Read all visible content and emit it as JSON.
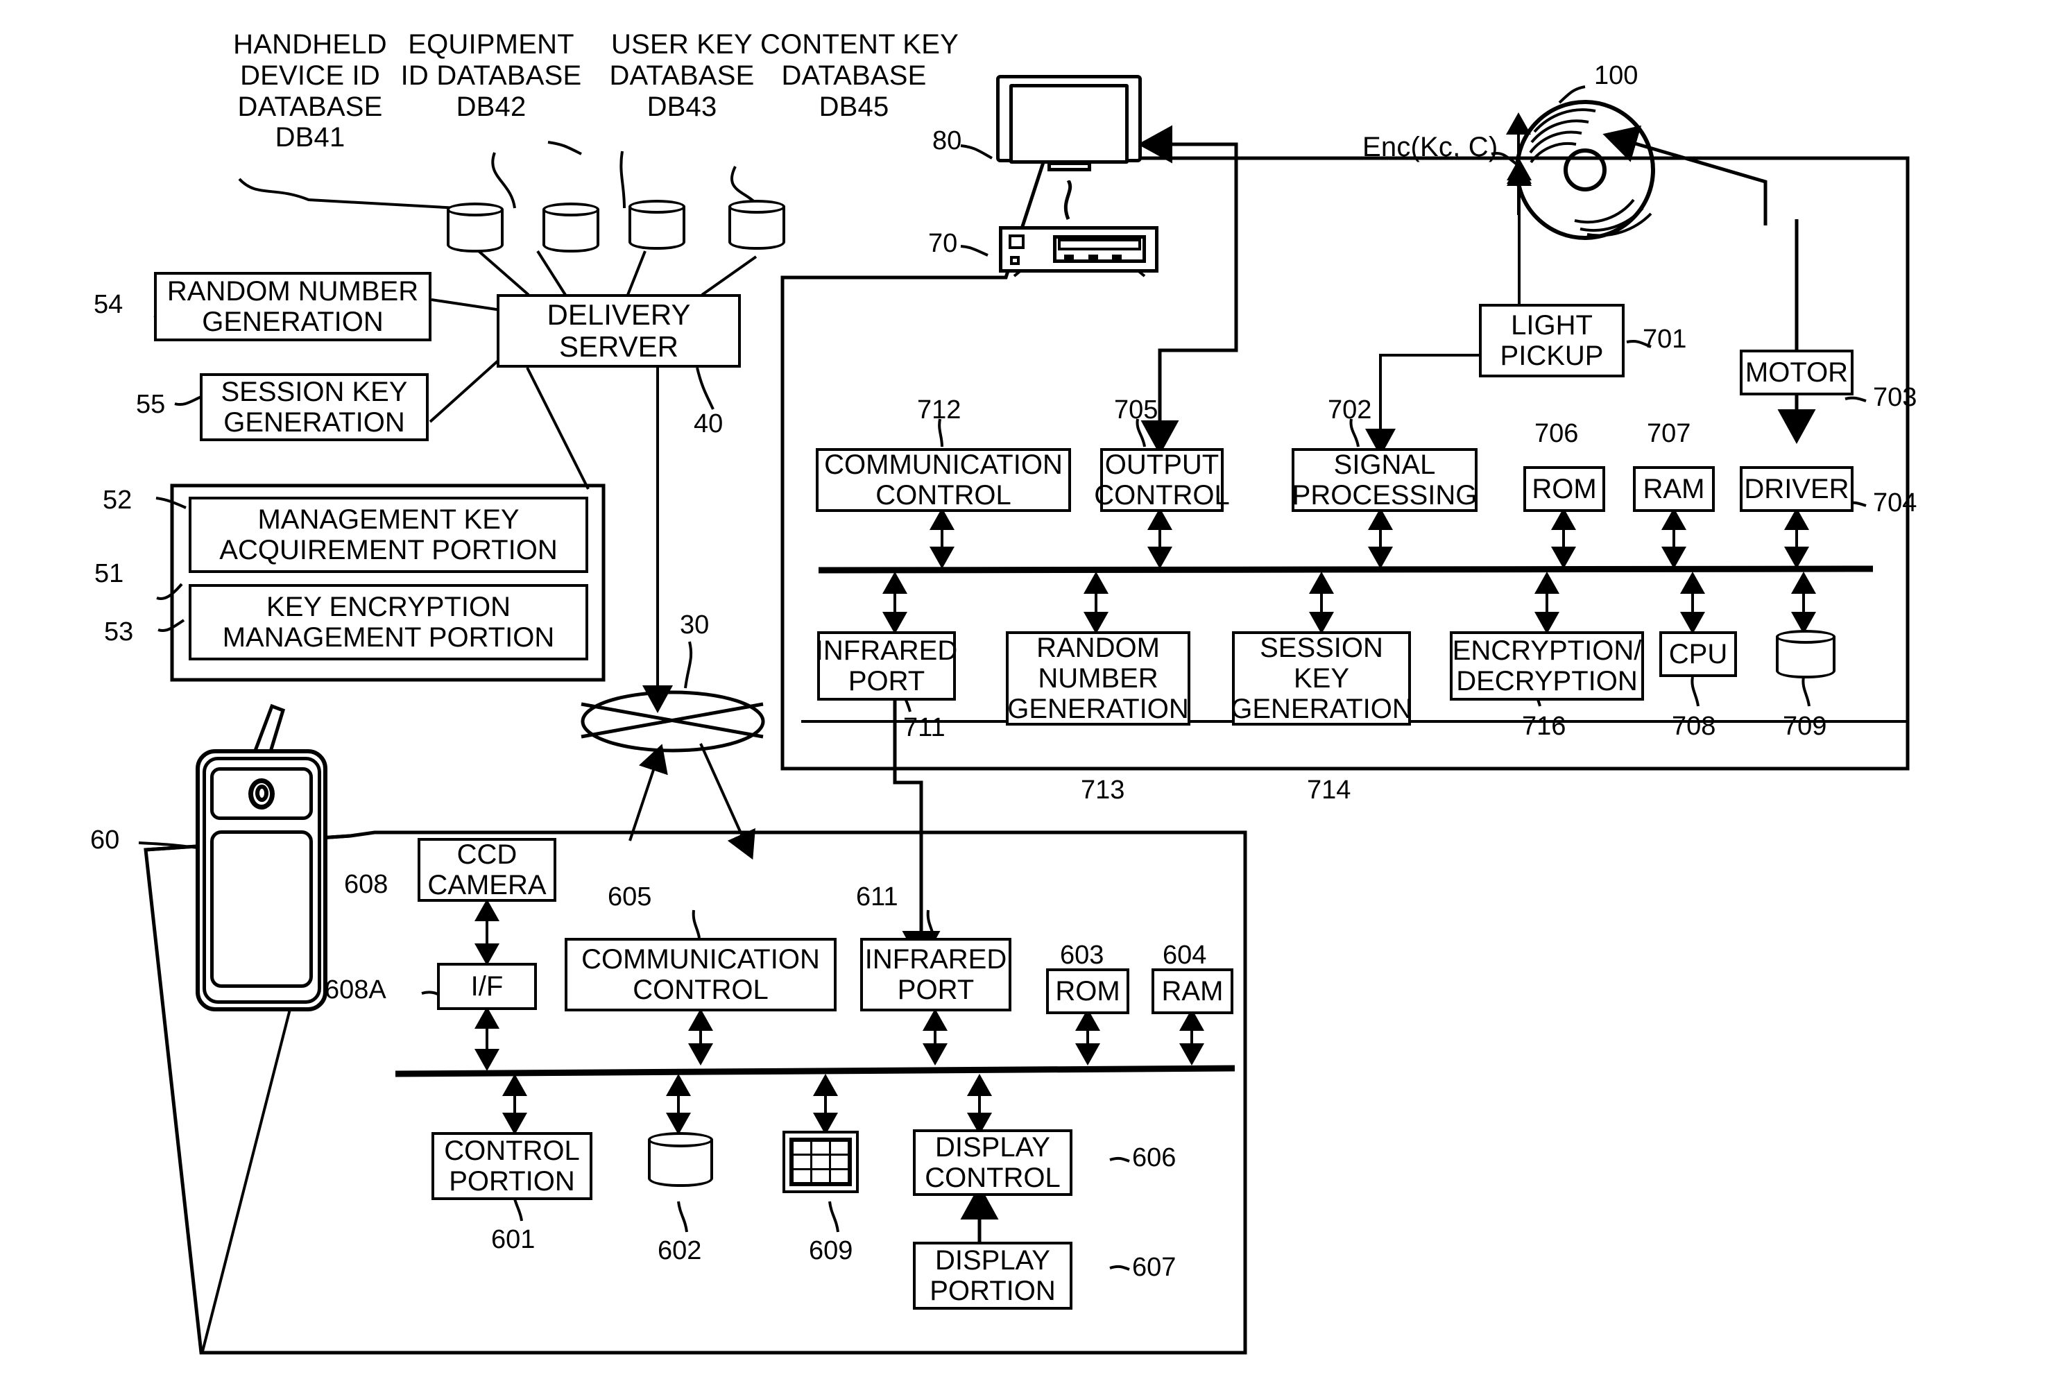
{
  "diagram": {
    "figure_kind": "patent-block-diagram",
    "top_labels": [
      {
        "text": "HANDHELD\nDEVICE ID\nDATABASE\nDB41"
      },
      {
        "text": "EQUIPMENT\nID DATABASE\nDB42"
      },
      {
        "text": "USER KEY\nDATABASE\nDB43"
      },
      {
        "text": "CONTENT KEY\nDATABASE\nDB45"
      }
    ],
    "disc_label": "Enc(Kc, C)",
    "server": {
      "title": "DELIVERY\nSERVER",
      "ref_network_40": "40",
      "ref_network_30": "30"
    },
    "server_side_blocks": [
      {
        "label": "RANDOM NUMBER\nGENERATION",
        "ref": "54"
      },
      {
        "label": "SESSION KEY\nGENERATION",
        "ref": "55"
      },
      {
        "label": "MANAGEMENT KEY\nACQUIREMENT PORTION",
        "ref": "52"
      },
      {
        "label": "KEY ENCRYPTION\nMANAGEMENT PORTION",
        "ref": "53"
      }
    ],
    "server_group_ref": "51",
    "devices": [
      {
        "name": "monitor",
        "ref": "80"
      },
      {
        "name": "player-deck",
        "ref": "70"
      },
      {
        "name": "optical-disc",
        "ref": "100"
      },
      {
        "name": "handheld-phone",
        "ref": "60"
      }
    ],
    "player_blocks": [
      {
        "label": "COMMUNICATION\nCONTROL",
        "ref": "712"
      },
      {
        "label": "OUTPUT\nCONTROL",
        "ref": "705"
      },
      {
        "label": "SIGNAL\nPROCESSING",
        "ref": "702"
      },
      {
        "label": "LIGHT\nPICKUP",
        "ref": "701"
      },
      {
        "label": "ROM",
        "ref": "706"
      },
      {
        "label": "RAM",
        "ref": "707"
      },
      {
        "label": "MOTOR",
        "ref": "703"
      },
      {
        "label": "DRIVER",
        "ref": "704"
      },
      {
        "label": "INFRARED\nPORT",
        "ref": "711"
      },
      {
        "label": "RANDOM\nNUMBER\nGENERATION",
        "ref": "713"
      },
      {
        "label": "SESSION\nKEY\nGENERATION",
        "ref": "714"
      },
      {
        "label": "ENCRYPTION/\nDECRYPTION",
        "ref": "716"
      },
      {
        "label": "CPU",
        "ref": "708"
      },
      {
        "label": "",
        "ref": "709",
        "shape": "cylinder-storage"
      }
    ],
    "handheld_blocks": [
      {
        "label": "CCD\nCAMERA",
        "ref": "608"
      },
      {
        "label": "I/F",
        "ref": "608A"
      },
      {
        "label": "COMMUNICATION\nCONTROL",
        "ref": "605"
      },
      {
        "label": "INFRARED\nPORT",
        "ref": "611"
      },
      {
        "label": "ROM",
        "ref": "603"
      },
      {
        "label": "RAM",
        "ref": "604"
      },
      {
        "label": "CONTROL\nPORTION",
        "ref": "601"
      },
      {
        "label": "",
        "ref": "602",
        "shape": "cylinder-storage"
      },
      {
        "label": "",
        "ref": "609",
        "shape": "keypad"
      },
      {
        "label": "DISPLAY\nCONTROL",
        "ref": "606"
      },
      {
        "label": "DISPLAY\nPORTION",
        "ref": "607"
      }
    ],
    "colors": {
      "ink": "#000000",
      "paper": "#ffffff"
    }
  }
}
